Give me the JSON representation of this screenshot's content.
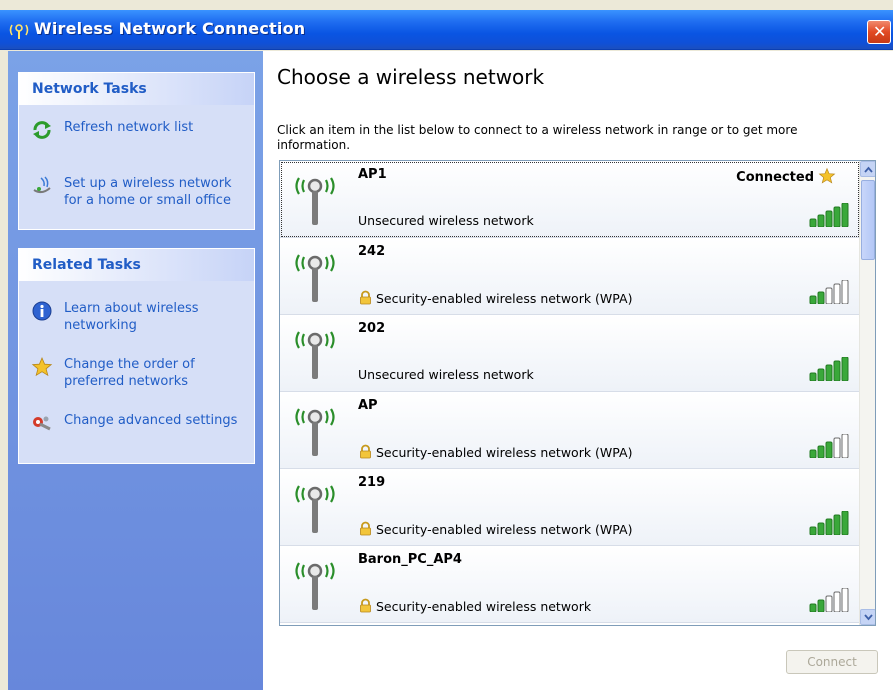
{
  "window": {
    "title": "Wireless Network Connection"
  },
  "left_pane": {
    "network_tasks": {
      "header": "Network Tasks",
      "items": [
        {
          "label": "Refresh network list",
          "icon": "refresh-icon"
        },
        {
          "label": "Set up a wireless network for a home or small office",
          "icon": "setup-wizard-icon"
        }
      ]
    },
    "related_tasks": {
      "header": "Related Tasks",
      "items": [
        {
          "label": "Learn about wireless networking",
          "icon": "info-icon"
        },
        {
          "label": "Change the order of preferred networks",
          "icon": "star-icon"
        },
        {
          "label": "Change advanced settings",
          "icon": "settings-icon"
        }
      ]
    }
  },
  "main": {
    "heading": "Choose a wireless network",
    "instruction": "Click an item in the list below to connect to a wireless network in range or to get more information.",
    "networks": [
      {
        "ssid": "AP1",
        "description": "Unsecured wireless network",
        "secured": false,
        "status": "Connected",
        "signal_bars": 5
      },
      {
        "ssid": "242",
        "description": "Security-enabled wireless network (WPA)",
        "secured": true,
        "status": "",
        "signal_bars": 2
      },
      {
        "ssid": "202",
        "description": "Unsecured wireless network",
        "secured": false,
        "status": "",
        "signal_bars": 5
      },
      {
        "ssid": "AP",
        "description": "Security-enabled wireless network (WPA)",
        "secured": true,
        "status": "",
        "signal_bars": 3
      },
      {
        "ssid": "219",
        "description": "Security-enabled wireless network (WPA)",
        "secured": true,
        "status": "",
        "signal_bars": 5
      },
      {
        "ssid": "Baron_PC_AP4",
        "description": "Security-enabled wireless network",
        "secured": true,
        "status": "",
        "signal_bars": 2
      }
    ],
    "connect_label": "Connect"
  },
  "colors": {
    "title_bar": "#0a55e3",
    "task_link": "#215dc6",
    "signal_on": "#3aa83a",
    "signal_off": "#ffffff"
  }
}
